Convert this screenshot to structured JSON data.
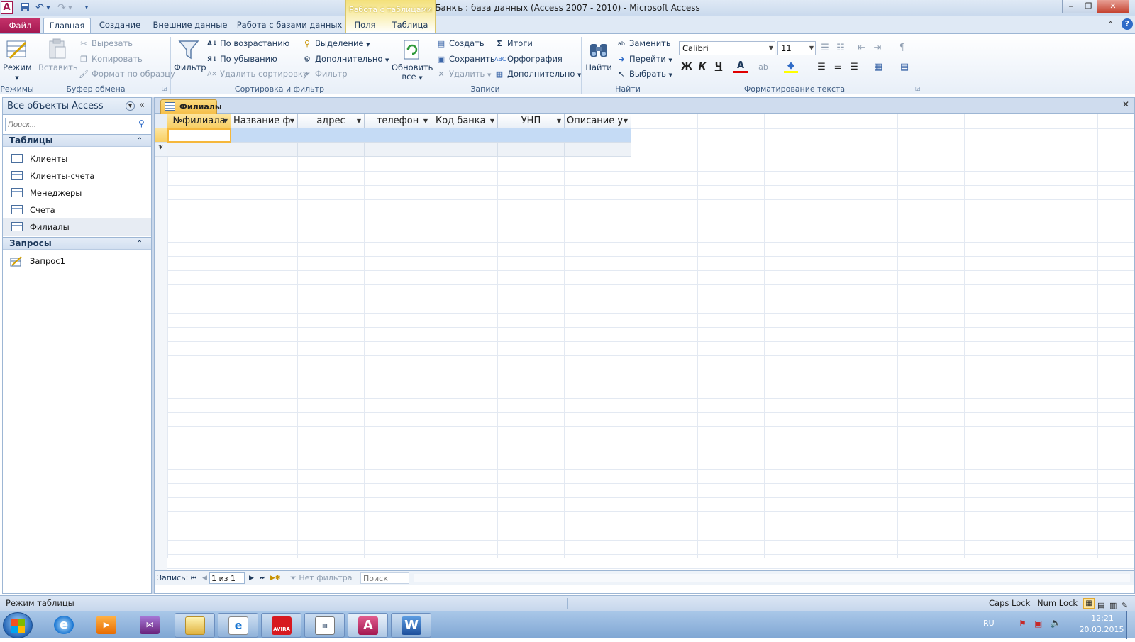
{
  "window": {
    "title": "Банкъ : база данных (Access 2007 - 2010)  -  Microsoft Access",
    "context_group": "Работа с таблицами"
  },
  "tabs": {
    "file": "Файл",
    "items": [
      "Главная",
      "Создание",
      "Внешние данные",
      "Работа с базами данных",
      "Поля",
      "Таблица"
    ]
  },
  "ribbon": {
    "views": {
      "mode": "Режим",
      "label": "Режимы"
    },
    "clipboard": {
      "paste": "Вставить",
      "cut": "Вырезать",
      "copy": "Копировать",
      "format_painter": "Формат по образцу",
      "label": "Буфер обмена"
    },
    "sort_filter": {
      "filter": "Фильтр",
      "ascending": "По возрастанию",
      "descending": "По убыванию",
      "remove_sort": "Удалить сортировку",
      "selection": "Выделение",
      "advanced": "Дополнительно",
      "toggle_filter": "Фильтр",
      "label": "Сортировка и фильтр"
    },
    "records": {
      "refresh": "Обновить",
      "refresh2": "все",
      "new": "Создать",
      "save": "Сохранить",
      "delete": "Удалить",
      "totals": "Итоги",
      "spelling": "Орфография",
      "more": "Дополнительно",
      "label": "Записи"
    },
    "find": {
      "find": "Найти",
      "replace": "Заменить",
      "goto": "Перейти",
      "select": "Выбрать",
      "label": "Найти"
    },
    "text_format": {
      "font": "Calibri",
      "size": "11",
      "bold": "Ж",
      "italic": "К",
      "underline": "Ч",
      "label": "Форматирование текста"
    }
  },
  "nav": {
    "header": "Все объекты Access",
    "search_placeholder": "Поиск...",
    "groups": [
      {
        "name": "Таблицы",
        "items": [
          "Клиенты",
          "Клиенты-счета",
          "Менеджеры",
          "Счета",
          "Филиалы"
        ]
      },
      {
        "name": "Запросы",
        "items": [
          "Запрос1"
        ]
      }
    ]
  },
  "document": {
    "tab": "Филиалы",
    "columns": [
      "№филиала",
      "Название ф",
      "адрес",
      "телефон",
      "Код банка",
      "УНП",
      "Описание у"
    ],
    "new_row_marker": "*"
  },
  "record_nav": {
    "label": "Запись:",
    "position": "1 из 1",
    "filter": "Нет фильтра",
    "search": "Поиск"
  },
  "status": {
    "mode": "Режим таблицы",
    "caps": "Caps Lock",
    "num": "Num Lock"
  },
  "tray": {
    "lang": "RU",
    "time": "12:21",
    "date": "20.03.2015"
  },
  "colors": {
    "file_tab": "#b01d59",
    "selected_header": "#f8cf64",
    "selected_row": "#c5dbf5"
  }
}
